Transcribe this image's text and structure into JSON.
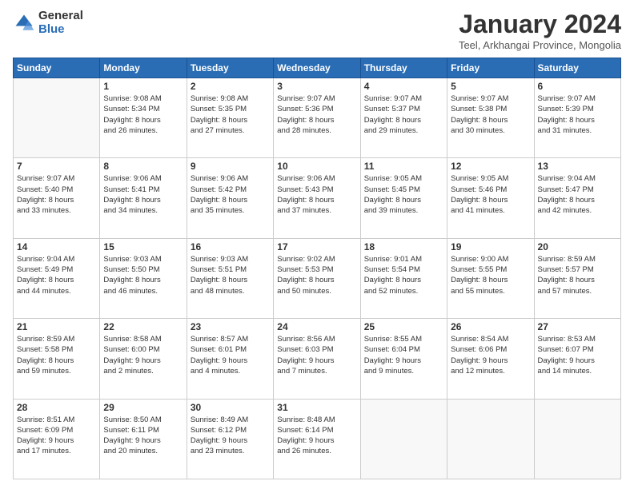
{
  "header": {
    "logo_general": "General",
    "logo_blue": "Blue",
    "title": "January 2024",
    "subtitle": "Teel, Arkhangai Province, Mongolia"
  },
  "days_of_week": [
    "Sunday",
    "Monday",
    "Tuesday",
    "Wednesday",
    "Thursday",
    "Friday",
    "Saturday"
  ],
  "weeks": [
    [
      {
        "day": "",
        "info": ""
      },
      {
        "day": "1",
        "info": "Sunrise: 9:08 AM\nSunset: 5:34 PM\nDaylight: 8 hours\nand 26 minutes."
      },
      {
        "day": "2",
        "info": "Sunrise: 9:08 AM\nSunset: 5:35 PM\nDaylight: 8 hours\nand 27 minutes."
      },
      {
        "day": "3",
        "info": "Sunrise: 9:07 AM\nSunset: 5:36 PM\nDaylight: 8 hours\nand 28 minutes."
      },
      {
        "day": "4",
        "info": "Sunrise: 9:07 AM\nSunset: 5:37 PM\nDaylight: 8 hours\nand 29 minutes."
      },
      {
        "day": "5",
        "info": "Sunrise: 9:07 AM\nSunset: 5:38 PM\nDaylight: 8 hours\nand 30 minutes."
      },
      {
        "day": "6",
        "info": "Sunrise: 9:07 AM\nSunset: 5:39 PM\nDaylight: 8 hours\nand 31 minutes."
      }
    ],
    [
      {
        "day": "7",
        "info": "Sunrise: 9:07 AM\nSunset: 5:40 PM\nDaylight: 8 hours\nand 33 minutes."
      },
      {
        "day": "8",
        "info": "Sunrise: 9:06 AM\nSunset: 5:41 PM\nDaylight: 8 hours\nand 34 minutes."
      },
      {
        "day": "9",
        "info": "Sunrise: 9:06 AM\nSunset: 5:42 PM\nDaylight: 8 hours\nand 35 minutes."
      },
      {
        "day": "10",
        "info": "Sunrise: 9:06 AM\nSunset: 5:43 PM\nDaylight: 8 hours\nand 37 minutes."
      },
      {
        "day": "11",
        "info": "Sunrise: 9:05 AM\nSunset: 5:45 PM\nDaylight: 8 hours\nand 39 minutes."
      },
      {
        "day": "12",
        "info": "Sunrise: 9:05 AM\nSunset: 5:46 PM\nDaylight: 8 hours\nand 41 minutes."
      },
      {
        "day": "13",
        "info": "Sunrise: 9:04 AM\nSunset: 5:47 PM\nDaylight: 8 hours\nand 42 minutes."
      }
    ],
    [
      {
        "day": "14",
        "info": "Sunrise: 9:04 AM\nSunset: 5:49 PM\nDaylight: 8 hours\nand 44 minutes."
      },
      {
        "day": "15",
        "info": "Sunrise: 9:03 AM\nSunset: 5:50 PM\nDaylight: 8 hours\nand 46 minutes."
      },
      {
        "day": "16",
        "info": "Sunrise: 9:03 AM\nSunset: 5:51 PM\nDaylight: 8 hours\nand 48 minutes."
      },
      {
        "day": "17",
        "info": "Sunrise: 9:02 AM\nSunset: 5:53 PM\nDaylight: 8 hours\nand 50 minutes."
      },
      {
        "day": "18",
        "info": "Sunrise: 9:01 AM\nSunset: 5:54 PM\nDaylight: 8 hours\nand 52 minutes."
      },
      {
        "day": "19",
        "info": "Sunrise: 9:00 AM\nSunset: 5:55 PM\nDaylight: 8 hours\nand 55 minutes."
      },
      {
        "day": "20",
        "info": "Sunrise: 8:59 AM\nSunset: 5:57 PM\nDaylight: 8 hours\nand 57 minutes."
      }
    ],
    [
      {
        "day": "21",
        "info": "Sunrise: 8:59 AM\nSunset: 5:58 PM\nDaylight: 8 hours\nand 59 minutes."
      },
      {
        "day": "22",
        "info": "Sunrise: 8:58 AM\nSunset: 6:00 PM\nDaylight: 9 hours\nand 2 minutes."
      },
      {
        "day": "23",
        "info": "Sunrise: 8:57 AM\nSunset: 6:01 PM\nDaylight: 9 hours\nand 4 minutes."
      },
      {
        "day": "24",
        "info": "Sunrise: 8:56 AM\nSunset: 6:03 PM\nDaylight: 9 hours\nand 7 minutes."
      },
      {
        "day": "25",
        "info": "Sunrise: 8:55 AM\nSunset: 6:04 PM\nDaylight: 9 hours\nand 9 minutes."
      },
      {
        "day": "26",
        "info": "Sunrise: 8:54 AM\nSunset: 6:06 PM\nDaylight: 9 hours\nand 12 minutes."
      },
      {
        "day": "27",
        "info": "Sunrise: 8:53 AM\nSunset: 6:07 PM\nDaylight: 9 hours\nand 14 minutes."
      }
    ],
    [
      {
        "day": "28",
        "info": "Sunrise: 8:51 AM\nSunset: 6:09 PM\nDaylight: 9 hours\nand 17 minutes."
      },
      {
        "day": "29",
        "info": "Sunrise: 8:50 AM\nSunset: 6:11 PM\nDaylight: 9 hours\nand 20 minutes."
      },
      {
        "day": "30",
        "info": "Sunrise: 8:49 AM\nSunset: 6:12 PM\nDaylight: 9 hours\nand 23 minutes."
      },
      {
        "day": "31",
        "info": "Sunrise: 8:48 AM\nSunset: 6:14 PM\nDaylight: 9 hours\nand 26 minutes."
      },
      {
        "day": "",
        "info": ""
      },
      {
        "day": "",
        "info": ""
      },
      {
        "day": "",
        "info": ""
      }
    ]
  ]
}
